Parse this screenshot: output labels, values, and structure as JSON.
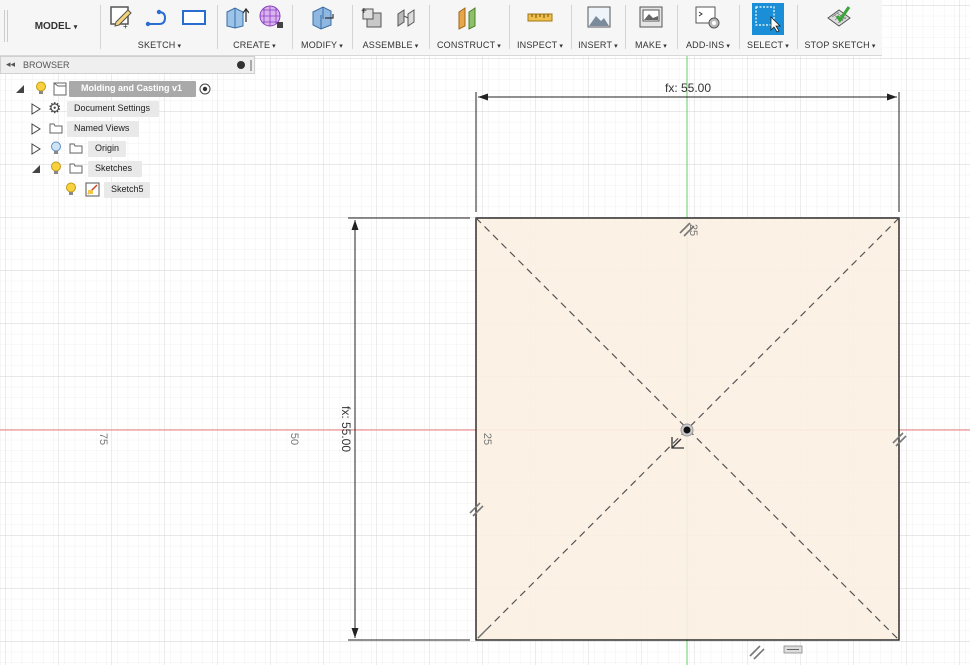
{
  "toolbar": {
    "workspace_label": "MODEL",
    "groups": [
      {
        "label": "SKETCH"
      },
      {
        "label": "CREATE"
      },
      {
        "label": "MODIFY"
      },
      {
        "label": "ASSEMBLE"
      },
      {
        "label": "CONSTRUCT"
      },
      {
        "label": "INSPECT"
      },
      {
        "label": "INSERT"
      },
      {
        "label": "MAKE"
      },
      {
        "label": "ADD-INS"
      },
      {
        "label": "SELECT"
      },
      {
        "label": "STOP SKETCH"
      }
    ],
    "caret": "▾",
    "accent": "#1a8fd8"
  },
  "browser": {
    "title": "BROWSER",
    "root": "Molding and Casting v1",
    "items": [
      {
        "label": "Document Settings",
        "icon": "gear-icon"
      },
      {
        "label": "Named Views",
        "icon": "folder-icon"
      },
      {
        "label": "Origin",
        "icon": "folder-icon"
      },
      {
        "label": "Sketches",
        "icon": "folder-icon"
      },
      {
        "label": "Sketch5",
        "icon": "sketch-icon"
      }
    ]
  },
  "sketch": {
    "horizontal_dimension": "fx: 55.00",
    "vertical_dimension": "fx: 55.00",
    "grid_labels": [
      "75",
      "50",
      "25",
      "25"
    ],
    "profile_fill": "#fcefe2",
    "x_axis_color": "#f08080",
    "y_axis_color": "#66cc66"
  }
}
